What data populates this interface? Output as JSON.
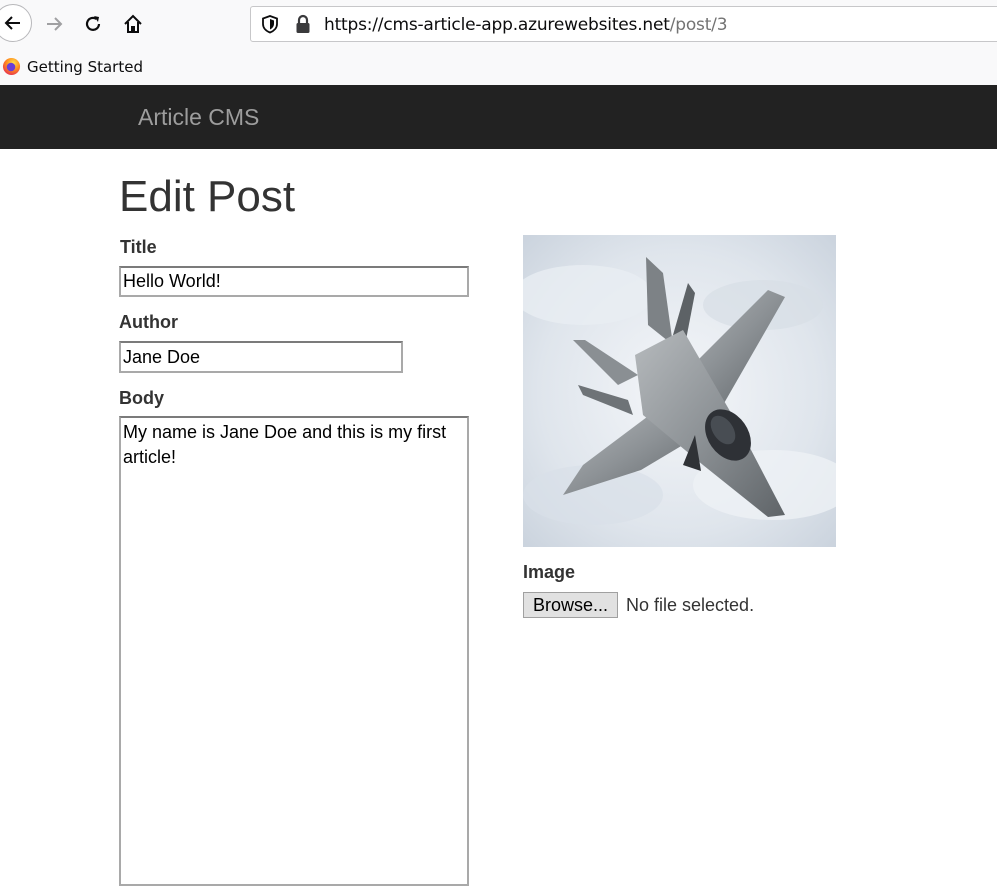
{
  "browser": {
    "url_host": "https://cms-article-app.azurewebsites.net",
    "url_path": "/post/3",
    "bookmark": "Getting Started"
  },
  "navbar": {
    "brand": "Article CMS"
  },
  "page": {
    "title": "Edit Post"
  },
  "form": {
    "title_label": "Title",
    "title_value": "Hello World!",
    "author_label": "Author",
    "author_value": "Jane Doe",
    "body_label": "Body",
    "body_value": "My name is Jane Doe and this is my first article!",
    "image_label": "Image",
    "browse_label": "Browse...",
    "file_status": "No file selected."
  },
  "icons": {
    "back": "back-arrow-icon",
    "forward": "forward-arrow-icon",
    "reload": "reload-icon",
    "home": "home-icon",
    "tracking": "tracking-protection-shield-icon",
    "lock": "lock-icon",
    "firefox": "firefox-logo-icon"
  }
}
